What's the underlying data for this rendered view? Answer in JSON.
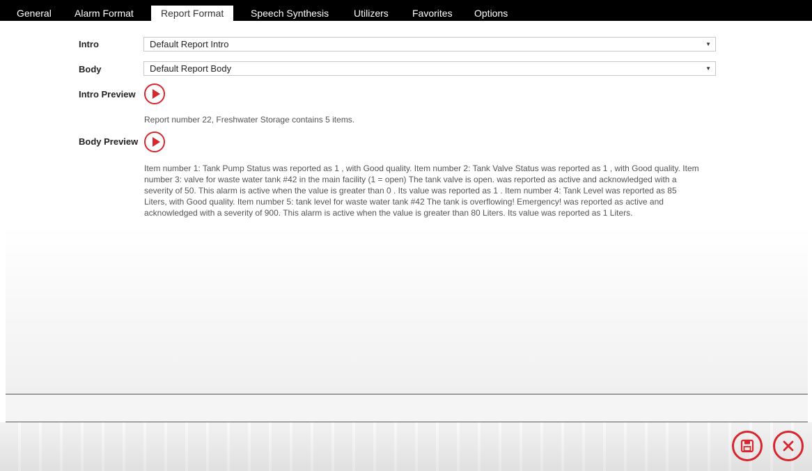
{
  "tabs": [
    {
      "label": "General",
      "active": false
    },
    {
      "label": "Alarm Format",
      "active": false
    },
    {
      "label": "Report Format",
      "active": true
    },
    {
      "label": "Speech Synthesis",
      "active": false
    },
    {
      "label": "Utilizers",
      "active": false
    },
    {
      "label": "Favorites",
      "active": false
    },
    {
      "label": "Options",
      "active": false
    }
  ],
  "form": {
    "intro_label": "Intro",
    "intro_value": "Default Report Intro",
    "body_label": "Body",
    "body_value": "Default Report Body",
    "intro_preview_label": "Intro Preview",
    "intro_preview_text": "Report number 22, Freshwater Storage contains 5 items.",
    "body_preview_label": "Body Preview",
    "body_preview_text": "Item number 1: Tank Pump Status was reported as 1 , with Good quality. Item number 2: Tank Valve Status was reported as 1 , with Good quality. Item number 3: valve for waste water tank #42 in the main facility (1 = open) The tank valve is open. was reported as active and acknowledged with a severity of 50. This alarm is active when the value is greater than 0 . Its value was reported as 1 . Item number 4: Tank Level was reported as 85 Liters, with Good quality. Item number 5: tank level for waste water tank #42 The tank is overflowing! Emergency! was reported as active and acknowledged with a severity of 900. This alarm is active when the value is greater than 80 Liters. Its value was reported as 1 Liters."
  },
  "icons": {
    "play": "play-icon",
    "save": "save-icon",
    "close": "close-icon",
    "dropdown": "chevron-down-icon"
  },
  "colors": {
    "accent": "#d7262e",
    "tabbar": "#000000"
  }
}
